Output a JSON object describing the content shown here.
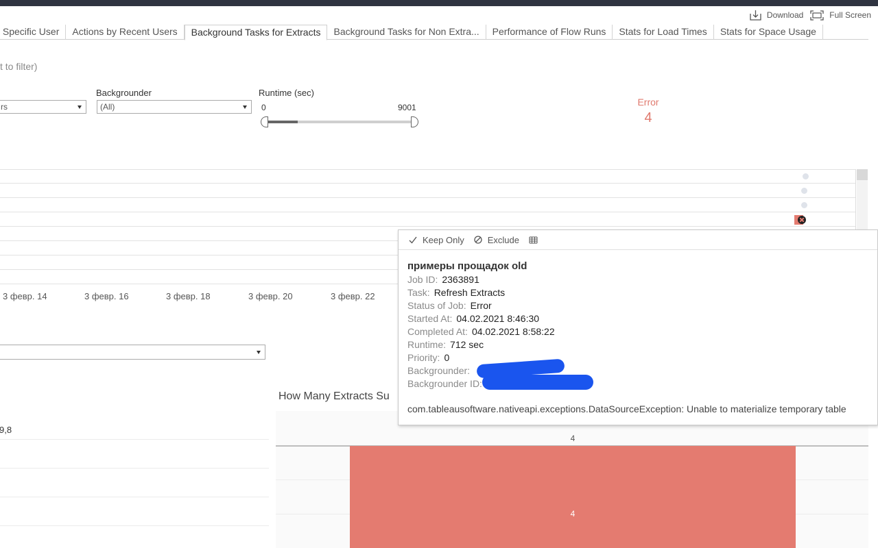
{
  "toolbar": {
    "download_label": "Download",
    "fullscreen_label": "Full Screen"
  },
  "tabs": [
    {
      "label": "y Specific User",
      "active": false
    },
    {
      "label": "Actions by Recent Users",
      "active": false
    },
    {
      "label": "Background Tasks for Extracts",
      "active": true
    },
    {
      "label": "Background Tasks for Non Extra...",
      "active": false
    },
    {
      "label": "Performance of Flow Runs",
      "active": false
    },
    {
      "label": "Stats for Load Times",
      "active": false
    },
    {
      "label": "Stats for Space Usage",
      "active": false
    }
  ],
  "filters": {
    "hint": "t to filter)",
    "first_dropdown_value": "rs",
    "backgrounder_label": "Backgrounder",
    "backgrounder_value": "(All)",
    "runtime_label": "Runtime (sec)",
    "runtime_min": "0",
    "runtime_max": "9001",
    "runtime_selected_fraction": 0.22
  },
  "kpi": {
    "label": "Error",
    "value": "4",
    "color": "#e07a6e"
  },
  "timeline": {
    "x_ticks": [
      "3 февр. 14",
      "3 февр. 16",
      "3 февр. 18",
      "3 февр. 20",
      "3 февр. 22"
    ]
  },
  "tooltip": {
    "actions": {
      "keep_only": "Keep Only",
      "exclude": "Exclude"
    },
    "title": "примеры прощадок old",
    "fields": [
      {
        "key": "Job ID:",
        "value": "2363891"
      },
      {
        "key": "Task:",
        "value": "Refresh Extracts"
      },
      {
        "key": "Status of Job:",
        "value": "Error"
      },
      {
        "key": "Started At:",
        "value": "04.02.2021 8:46:30"
      },
      {
        "key": "Completed At:",
        "value": "04.02.2021 8:58:22"
      },
      {
        "key": "Runtime:",
        "value": "712 sec"
      },
      {
        "key": "Priority:",
        "value": "0"
      },
      {
        "key": "Backgrounder:",
        "value": ""
      },
      {
        "key": "Backgrounder ID:",
        "value": ""
      }
    ],
    "message": "com.tableausoftware.nativeapi.exceptions.DataSourceException: Unable to materialize temporary table"
  },
  "lower_left": {
    "value_label": "9,8"
  },
  "chart2": {
    "title": "How Many Extracts Su",
    "bar_color": "#e47b70"
  },
  "chart_data": {
    "type": "bar",
    "categories": [
      ""
    ],
    "values": [
      4
    ],
    "title": "How Many Extracts Su",
    "data_labels": [
      "4",
      "4"
    ]
  }
}
